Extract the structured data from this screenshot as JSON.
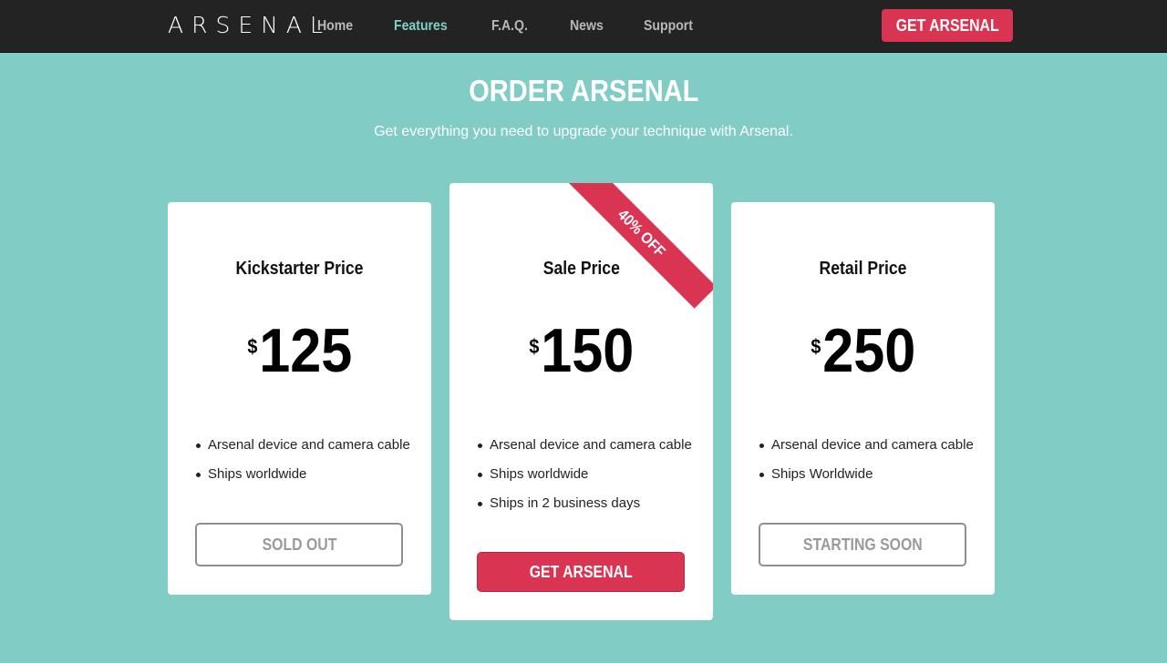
{
  "nav": {
    "logo": "ARSENAL",
    "links": [
      "Home",
      "Features",
      "F.A.Q.",
      "News",
      "Support"
    ],
    "active_link": "Features",
    "cta_label": "GET ARSENAL"
  },
  "section": {
    "title": "ORDER ARSENAL",
    "subtitle": "Get everything you need to upgrade your technique with Arsenal."
  },
  "cards": [
    {
      "title": "Kickstarter Price",
      "currency": "$",
      "price": "125",
      "features": [
        "Arsenal device and camera cable",
        "Ships worldwide"
      ],
      "button_label": "SOLD OUT"
    },
    {
      "title": "Sale Price",
      "currency": "$",
      "price": "150",
      "ribbon": "40% OFF",
      "features": [
        "Arsenal device and camera cable",
        "Ships worldwide",
        "Ships in 2 business days"
      ],
      "button_label": "GET ARSENAL"
    },
    {
      "title": "Retail Price",
      "currency": "$",
      "price": "250",
      "features": [
        "Arsenal device and camera cable",
        "Ships Worldwide"
      ],
      "button_label": "STARTING SOON"
    }
  ],
  "colors": {
    "background": "#81cdc6",
    "navbar": "#232323",
    "accent": "#d93452",
    "active_link": "#7fd1c9"
  }
}
